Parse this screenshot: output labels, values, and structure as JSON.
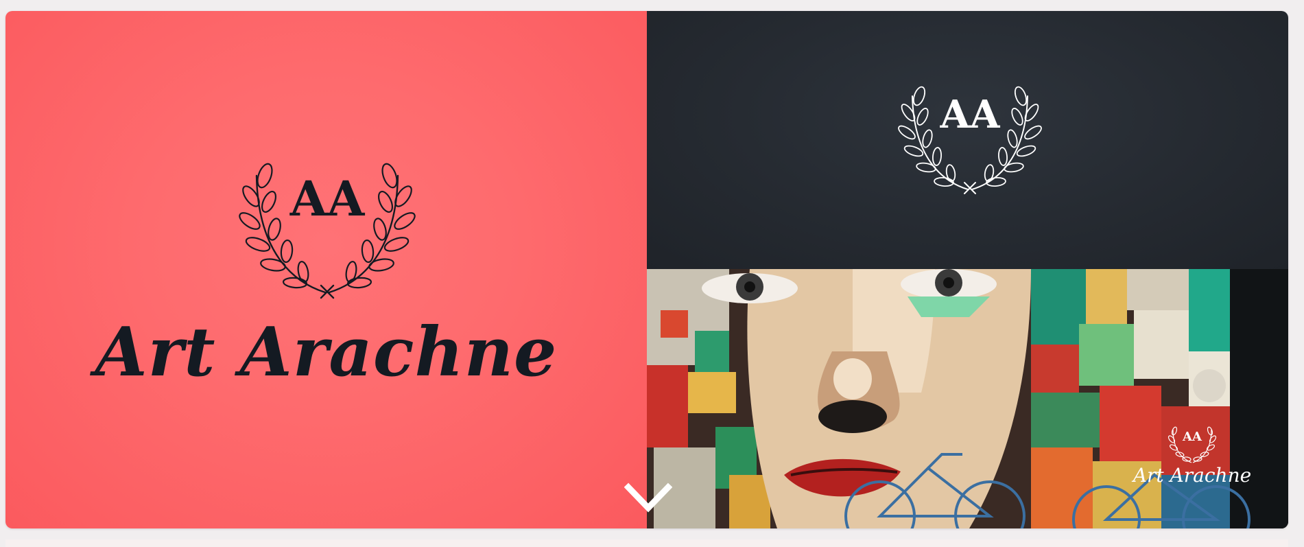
{
  "brand": {
    "name": "Art Arachne",
    "monogram": "AA"
  },
  "colors": {
    "left_panel": "#fd6a6e",
    "right_top_panel": "#262b32",
    "logo_dark": "#141a22",
    "logo_light": "#ffffff"
  },
  "icons": {
    "scroll": "chevron-down-icon",
    "wreath": "laurel-wreath-icon"
  }
}
